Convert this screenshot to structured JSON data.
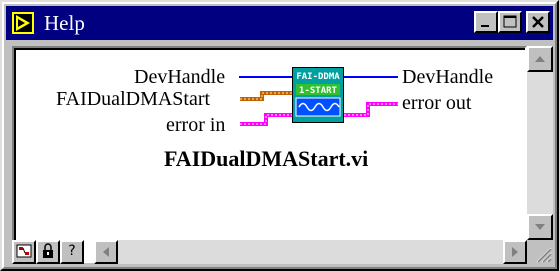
{
  "window": {
    "title": "Help"
  },
  "titlebar_buttons": {
    "minimize": "_",
    "maximize": "□",
    "close": "×"
  },
  "connector": {
    "inputs": [
      "DevHandle",
      "FAIDualDMAStart",
      "error in"
    ],
    "outputs": [
      "DevHandle",
      "error out"
    ],
    "icon_lines": [
      "FAI-DDMA",
      "1-START"
    ]
  },
  "vi_name": "FAIDualDMAStart.vi",
  "bottom_buttons": [
    "?"
  ],
  "colors": {
    "title_bg": "#000080",
    "wire_blue": "#0000ff",
    "wire_orange": "#c06000",
    "wire_pink": "#ff00ff",
    "icon_bg": "#00a0a0",
    "icon_green": "#30c030"
  }
}
